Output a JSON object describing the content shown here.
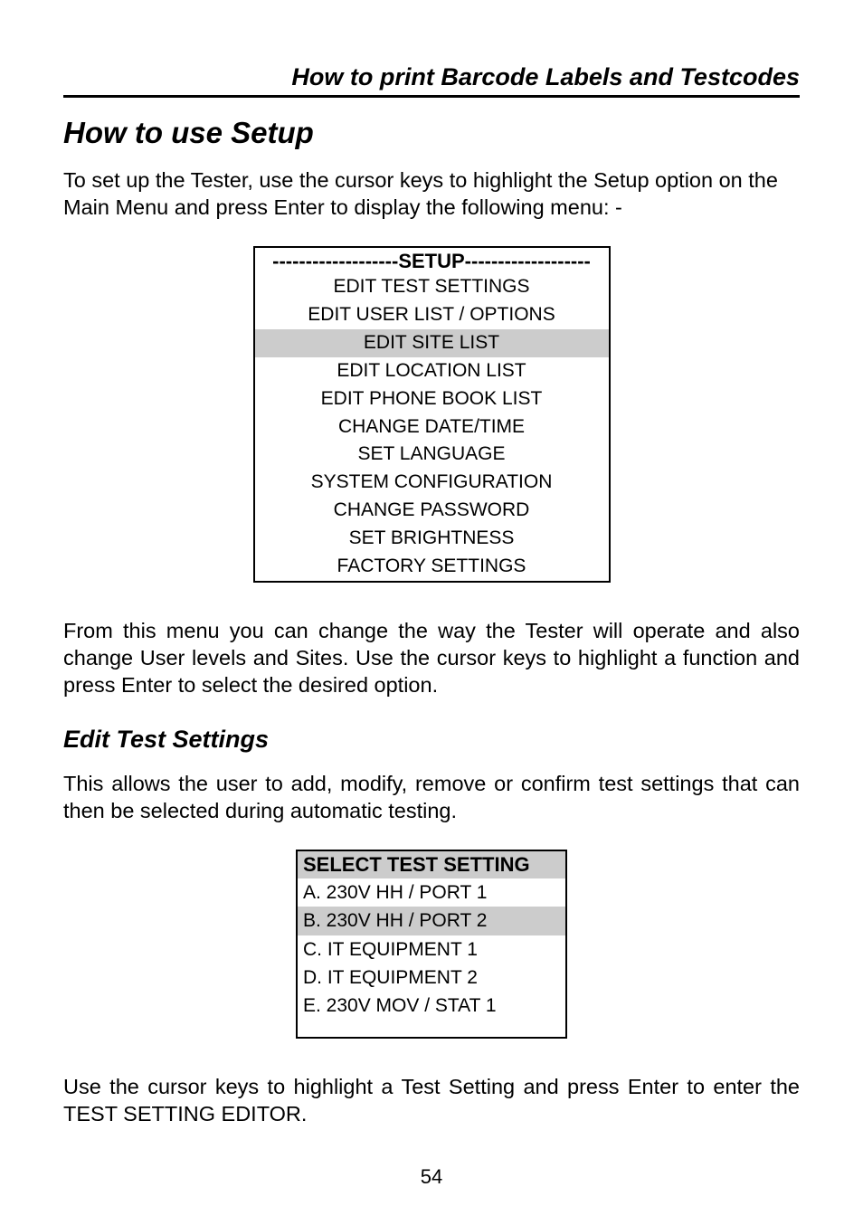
{
  "header": "How to print Barcode Labels and Testcodes",
  "title": "How to use Setup",
  "intro": "To set up the Tester, use the cursor keys to highlight the Setup option on the Main Menu and press Enter to display the following menu: -",
  "setupMenu": {
    "title": "-------------------SETUP-------------------",
    "items": [
      {
        "label": "EDIT TEST SETTINGS",
        "highlight": false
      },
      {
        "label": "EDIT USER LIST / OPTIONS",
        "highlight": false
      },
      {
        "label": "EDIT SITE LIST",
        "highlight": true
      },
      {
        "label": "EDIT LOCATION LIST",
        "highlight": false
      },
      {
        "label": "EDIT PHONE BOOK LIST",
        "highlight": false
      },
      {
        "label": "CHANGE DATE/TIME",
        "highlight": false
      },
      {
        "label": "SET LANGUAGE",
        "highlight": false
      },
      {
        "label": "SYSTEM CONFIGURATION",
        "highlight": false
      },
      {
        "label": "CHANGE PASSWORD",
        "highlight": false
      },
      {
        "label": "SET BRIGHTNESS",
        "highlight": false
      },
      {
        "label": "FACTORY SETTINGS",
        "highlight": false
      }
    ]
  },
  "para2": "From this menu you can change the way the Tester will operate and also change User levels and Sites.  Use the cursor keys to highlight a function and press Enter to select the desired option.",
  "subheading": "Edit Test Settings",
  "para3": "This allows the user to add, modify, remove or confirm test settings that can then be selected during automatic testing.",
  "selectMenu": {
    "title": "SELECT TEST SETTING",
    "items": [
      {
        "label": "A. 230V HH / PORT 1",
        "highlight": false
      },
      {
        "label": "B. 230V HH / PORT 2",
        "highlight": true
      },
      {
        "label": "C. IT  EQUIPMENT 1",
        "highlight": false
      },
      {
        "label": "D. IT EQUIPMENT 2",
        "highlight": false
      },
      {
        "label": "E. 230V MOV / STAT 1",
        "highlight": false
      }
    ]
  },
  "para4": "Use the cursor keys to highlight a Test Setting and press Enter to enter the TEST SETTING EDITOR.",
  "pageNumber": "54"
}
